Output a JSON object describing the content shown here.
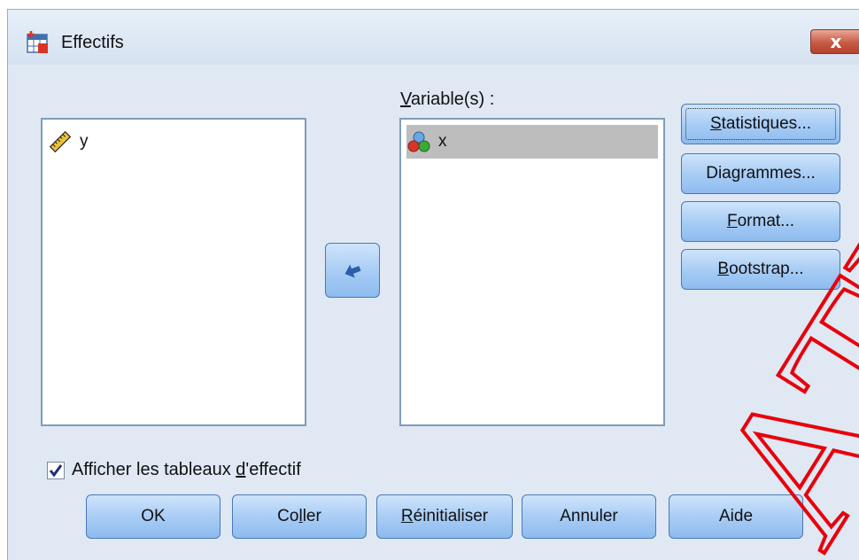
{
  "window": {
    "title": "Effectifs",
    "close_label": "x"
  },
  "source_list": {
    "items": [
      {
        "label": "y",
        "icon": "ruler-scale-icon"
      }
    ]
  },
  "target_list": {
    "label_prefix": "V",
    "label_rest": "ariable(s) :",
    "items": [
      {
        "label": "x",
        "icon": "nominal-variable-icon",
        "selected": true
      }
    ]
  },
  "move_button": {
    "icon": "arrow-left-icon"
  },
  "side_buttons": [
    {
      "pre": "",
      "ul": "S",
      "post": "tatistiques...",
      "name": "statistiques-button"
    },
    {
      "pre": "",
      "ul": "",
      "post": "Diagrammes...",
      "name": "diagrammes-button"
    },
    {
      "pre": "",
      "ul": "F",
      "post": "ormat...",
      "name": "format-button"
    },
    {
      "pre": "",
      "ul": "B",
      "post": "ootstrap...",
      "name": "bootstrap-button"
    }
  ],
  "checkbox": {
    "pre": "Afficher les tableaux ",
    "ul": "d",
    "post": "'effectif",
    "checked": true
  },
  "bottom_buttons": [
    {
      "pre": "OK",
      "ul": "",
      "post": "",
      "name": "ok-button"
    },
    {
      "pre": "Co",
      "ul": "l",
      "post": "ler",
      "name": "coller-button"
    },
    {
      "pre": "",
      "ul": "R",
      "post": "éinitialiser",
      "name": "reinitialiser-button"
    },
    {
      "pre": "Annuler",
      "ul": "",
      "post": "",
      "name": "annuler-button"
    },
    {
      "pre": "Aide",
      "ul": "",
      "post": "",
      "name": "aide-button"
    }
  ],
  "watermark": {
    "text": "ATNA",
    "color": "#e8000c"
  }
}
